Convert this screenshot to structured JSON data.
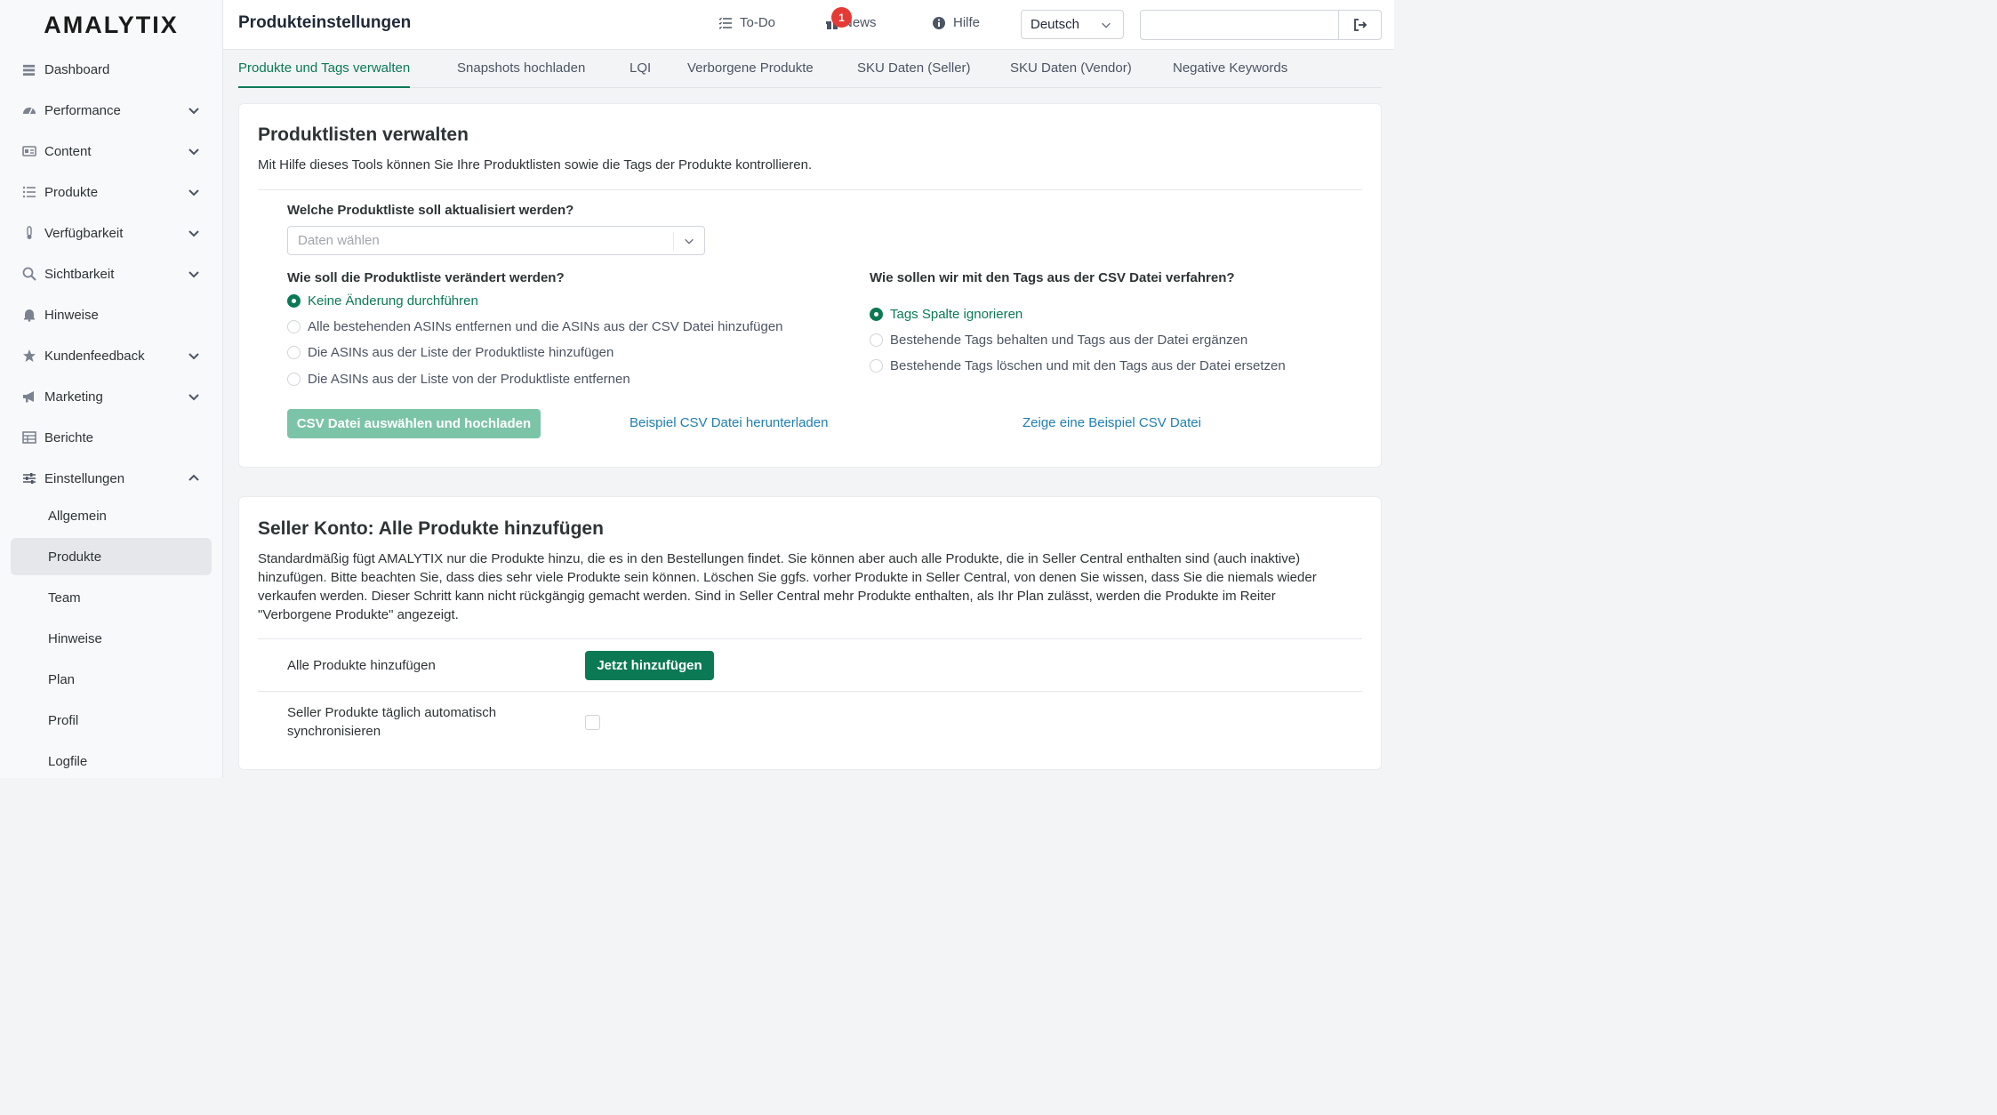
{
  "app": {
    "logo": "AMALYTIX"
  },
  "sidebar": {
    "items": [
      {
        "label": "Dashboard"
      },
      {
        "label": "Performance"
      },
      {
        "label": "Content"
      },
      {
        "label": "Produkte"
      },
      {
        "label": "Verfügbarkeit"
      },
      {
        "label": "Sichtbarkeit"
      },
      {
        "label": "Hinweise"
      },
      {
        "label": "Kundenfeedback"
      },
      {
        "label": "Marketing"
      },
      {
        "label": "Berichte"
      },
      {
        "label": "Einstellungen"
      }
    ],
    "subitems": [
      {
        "label": "Allgemein"
      },
      {
        "label": "Produkte"
      },
      {
        "label": "Team"
      },
      {
        "label": "Hinweise"
      },
      {
        "label": "Plan"
      },
      {
        "label": "Profil"
      },
      {
        "label": "Logfile"
      }
    ]
  },
  "header": {
    "title": "Produkteinstellungen",
    "todo": "To-Do",
    "news": "News",
    "news_badge": "1",
    "help": "Hilfe",
    "language": "Deutsch",
    "search_value": ""
  },
  "tabs": [
    {
      "label": "Produkte und Tags verwalten"
    },
    {
      "label": "Snapshots hochladen"
    },
    {
      "label": "LQI"
    },
    {
      "label": "Verborgene Produkte"
    },
    {
      "label": "SKU Daten (Seller)"
    },
    {
      "label": "SKU Daten (Vendor)"
    },
    {
      "label": "Negative Keywords"
    }
  ],
  "card1": {
    "title": "Produktlisten verwalten",
    "description": "Mit Hilfe dieses Tools können Sie Ihre Produktlisten sowie die Tags der Produkte kontrollieren.",
    "q1": "Welche Produktliste soll aktualisiert werden?",
    "select_placeholder": "Daten wählen",
    "q2": "Wie soll die Produktliste verändert werden?",
    "list_options": [
      "Keine Änderung durchführen",
      "Alle bestehenden ASINs entfernen und die ASINs aus der CSV Datei hinzufügen",
      "Die ASINs aus der Liste der Produktliste hinzufügen",
      "Die ASINs aus der Liste von der Produktliste entfernen"
    ],
    "q3": "Wie sollen wir mit den Tags aus der CSV Datei verfahren?",
    "tag_options": [
      "Tags Spalte ignorieren",
      "Bestehende Tags behalten und Tags aus der Datei ergänzen",
      "Bestehende Tags löschen und mit den Tags aus der Datei ersetzen"
    ],
    "upload_button": "CSV Datei auswählen und hochladen",
    "download_link": "Beispiel CSV Datei herunterladen",
    "show_link": "Zeige eine Beispiel CSV Datei"
  },
  "card2": {
    "title": "Seller Konto: Alle Produkte hinzufügen",
    "description_lines": [
      "Standardmäßig fügt AMALYTIX nur die Produkte hinzu, die es in den Bestellungen findet. Sie können aber auch alle Produkte, die in Seller Central enthalten sind (auch inaktive)",
      "hinzufügen. Bitte beachten Sie, dass dies sehr viele Produkte sein können. Löschen Sie ggfs. vorher Produkte in Seller Central, von denen Sie wissen, dass Sie die niemals wieder",
      "verkaufen werden. Dieser Schritt kann nicht rückgängig gemacht werden. Sind in Seller Central mehr Produkte enthalten, als Ihr Plan zulässt, werden die Produkte im Reiter",
      "\"Verborgene Produkte\" angezeigt."
    ],
    "add_all_label": "Alle Produkte hinzufügen",
    "add_button": "Jetzt hinzufügen",
    "sync_label_1": "Seller Produkte täglich automatisch",
    "sync_label_2": "synchronisieren"
  },
  "colors": {
    "accent": "#0b7a54",
    "accent_light": "#7cc4a7",
    "link": "#1f7fb0",
    "badge": "#e53935"
  }
}
